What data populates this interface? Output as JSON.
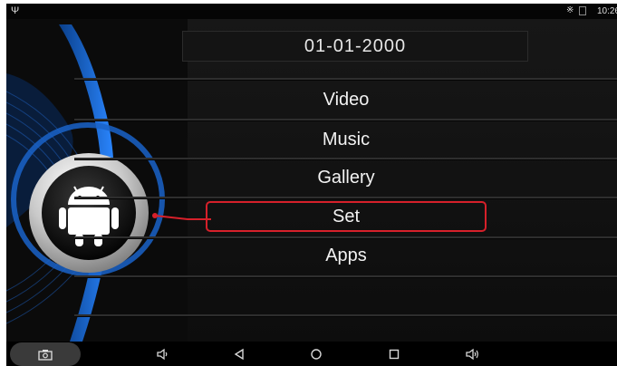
{
  "status_bar": {
    "usb_icon": "usb-icon",
    "bluetooth_icon": "bluetooth-icon",
    "signal_icon": "signal-icon",
    "time": "10:26"
  },
  "date": "01-01-2000",
  "menu": {
    "items": [
      {
        "label": "Video"
      },
      {
        "label": "Music"
      },
      {
        "label": "Gallery"
      },
      {
        "label": "Set"
      },
      {
        "label": "Apps"
      }
    ],
    "selected_index": 3
  },
  "center_icon": "android-robot-icon",
  "nav_bar": {
    "buttons": [
      "camera-icon",
      "volume-down-icon",
      "back-icon",
      "home-icon",
      "recents-icon",
      "volume-up-icon"
    ]
  },
  "colors": {
    "accent_blue": "#1c6fd6",
    "selection_red": "#d6202a",
    "background": "#0b0b0b"
  }
}
